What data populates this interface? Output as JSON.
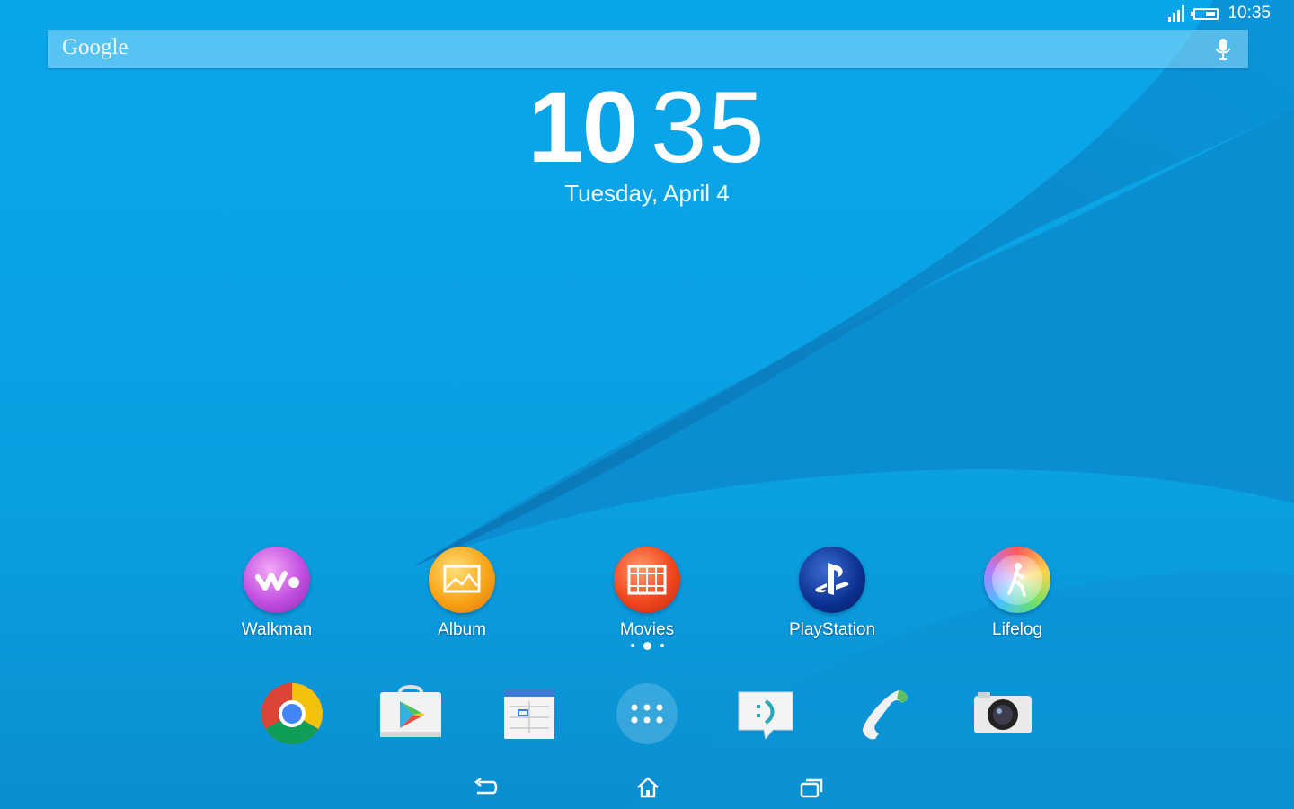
{
  "status_bar": {
    "time": "10:35",
    "signal_bars": 4,
    "battery_level": 0.4
  },
  "search": {
    "logo_text": "Google"
  },
  "clock": {
    "hours": "10",
    "minutes": "35",
    "date": "Tuesday, April 4"
  },
  "apps": [
    {
      "label": "Walkman",
      "icon": "walkman-icon"
    },
    {
      "label": "Album",
      "icon": "album-icon"
    },
    {
      "label": "Movies",
      "icon": "movies-icon"
    },
    {
      "label": "PlayStation",
      "icon": "playstation-icon"
    },
    {
      "label": "Lifelog",
      "icon": "lifelog-icon"
    }
  ],
  "pager": {
    "pages": 3,
    "current": 2
  },
  "dock": [
    {
      "icon": "chrome-icon"
    },
    {
      "icon": "play-store-icon"
    },
    {
      "icon": "calendar-icon"
    },
    {
      "icon": "app-drawer-icon"
    },
    {
      "icon": "messaging-icon"
    },
    {
      "icon": "phone-icon"
    },
    {
      "icon": "camera-icon"
    }
  ],
  "navigation": {
    "back": "back-icon",
    "home": "home-icon",
    "recents": "recent-apps-icon"
  },
  "colors": {
    "wallpaper": "#0aa3e6",
    "wave": "#0a7fc0"
  }
}
